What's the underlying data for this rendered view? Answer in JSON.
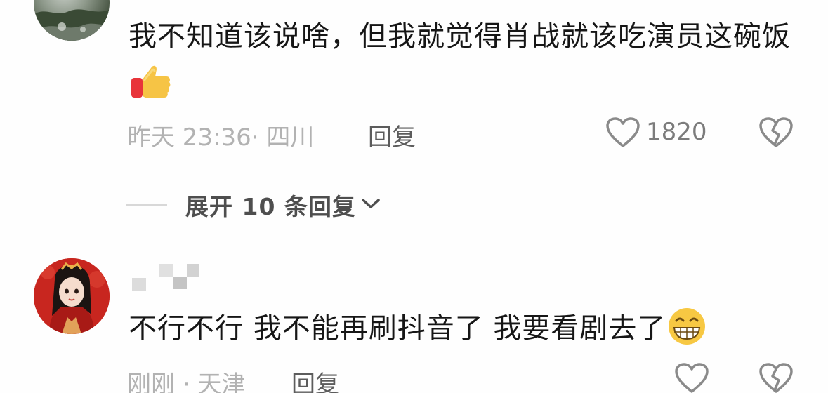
{
  "comments": [
    {
      "text": "我不知道该说啥，但我就觉得肖战就该吃演员这碗饭",
      "emoji": "thumbs-up-emoji",
      "time": "昨天 23:36",
      "location": "· 四川",
      "reply_label": "回复",
      "like_count": "1820",
      "expand_label": "展开 10 条回复"
    },
    {
      "text": "不行不行 我不能再刷抖音了 我要看剧去了",
      "emoji": "grinning-emoji",
      "time": "刚刚",
      "location": "· 天津",
      "reply_label": "回复",
      "like_count": ""
    }
  ],
  "icons": {
    "like": "heart-outline-icon",
    "dislike": "broken-heart-icon",
    "expand": "chevron-down-icon"
  },
  "colors": {
    "text": "#161616",
    "meta": "#b2b2b2",
    "reply": "#5c5c5c",
    "icon": "#8a8a8a"
  }
}
